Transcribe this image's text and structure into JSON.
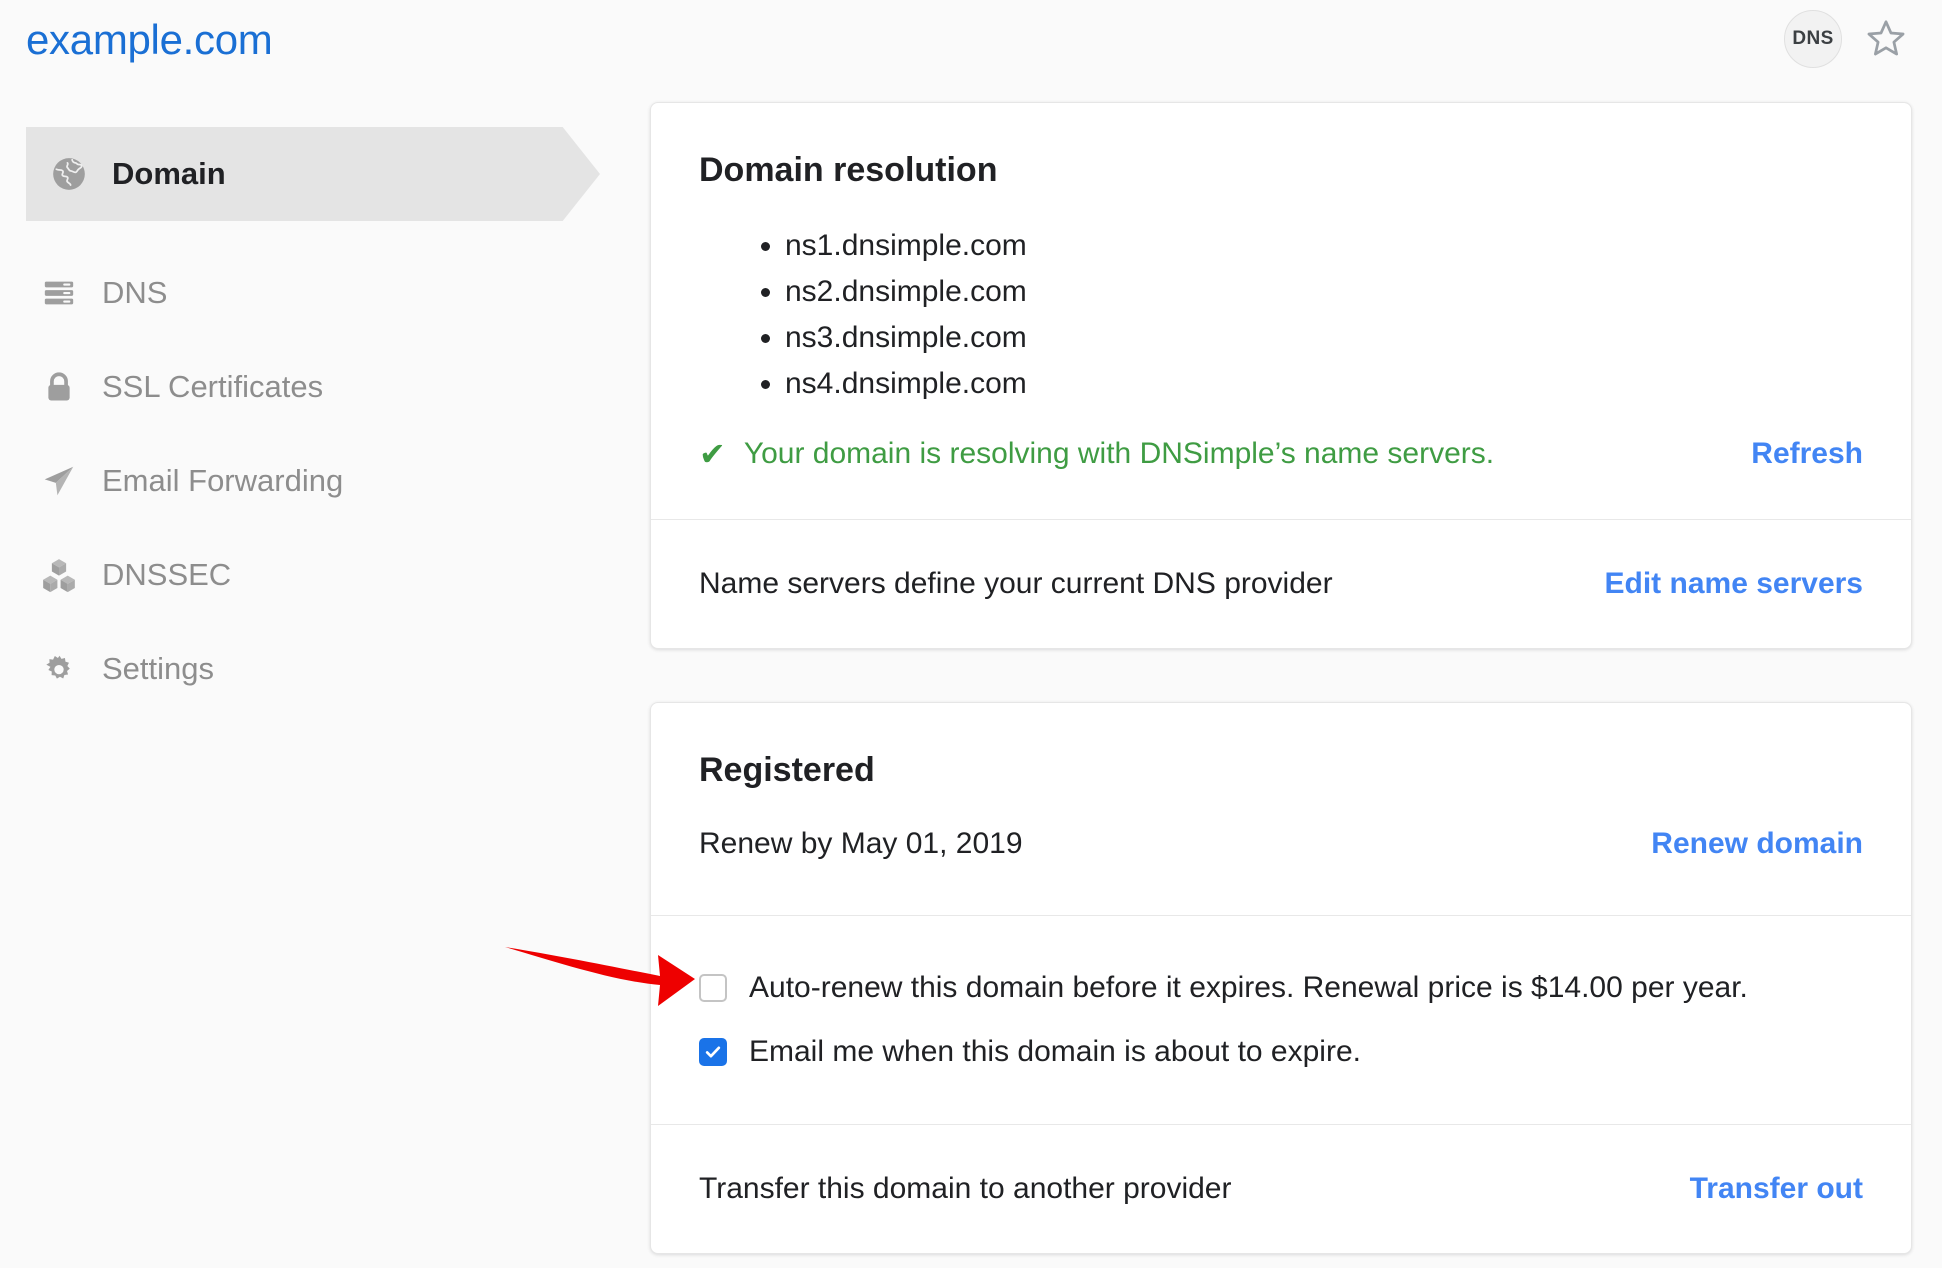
{
  "header": {
    "domain_title": "example.com",
    "dns_badge_label": "DNS",
    "star_icon": "star-outline-icon"
  },
  "sidebar": {
    "items": [
      {
        "label": "Domain",
        "icon": "globe-icon",
        "active": true
      },
      {
        "label": "DNS",
        "icon": "dns-records-icon",
        "active": false
      },
      {
        "label": "SSL Certificates",
        "icon": "lock-icon",
        "active": false
      },
      {
        "label": "Email Forwarding",
        "icon": "paper-plane-icon",
        "active": false
      },
      {
        "label": "DNSSEC",
        "icon": "cubes-icon",
        "active": false
      },
      {
        "label": "Settings",
        "icon": "gear-icon",
        "active": false
      }
    ]
  },
  "resolution_card": {
    "title": "Domain resolution",
    "name_servers": [
      "ns1.dnsimple.com",
      "ns2.dnsimple.com",
      "ns3.dnsimple.com",
      "ns4.dnsimple.com"
    ],
    "status_check_icon": "✔",
    "status_text": "Your domain is resolving with DNSimple’s name servers.",
    "status_color": "#3f9c43",
    "refresh_label": "Refresh",
    "nameserver_info_text": "Name servers define your current DNS provider",
    "edit_name_servers_label": "Edit name servers"
  },
  "registered_card": {
    "title": "Registered",
    "renew_by_text": "Renew by May 01, 2019",
    "renew_domain_label": "Renew domain",
    "auto_renew": {
      "label": "Auto-renew this domain before it expires. Renewal price is $14.00 per year.",
      "checked": false
    },
    "expire_email": {
      "label": "Email me when this domain is about to expire.",
      "checked": true
    },
    "transfer_text": "Transfer this domain to another provider",
    "transfer_out_label": "Transfer out"
  },
  "annotation": {
    "arrow_icon": "red-arrow-pointing-right",
    "arrow_color": "#ee0000"
  },
  "colors": {
    "link_blue": "#4285f4",
    "title_blue": "#1a6fd4",
    "success_green": "#3f9c43",
    "checkbox_blue": "#1a73e8",
    "page_background": "#fafafa",
    "active_nav_background": "#e4e4e4"
  }
}
